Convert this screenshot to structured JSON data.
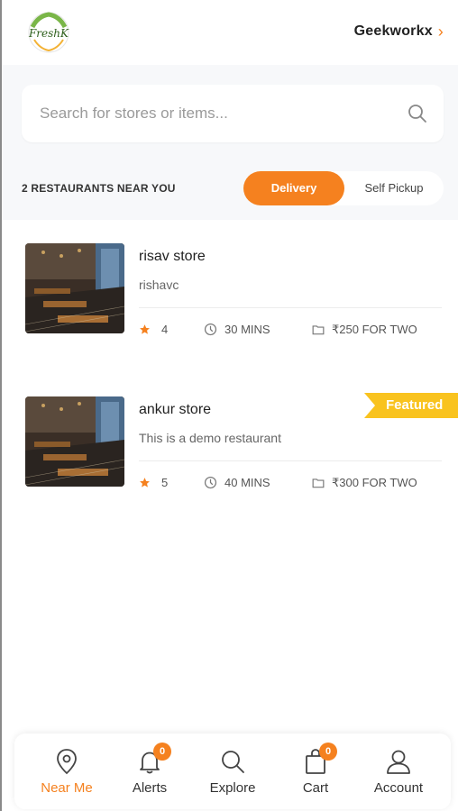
{
  "header": {
    "location_label": "Geekworkx",
    "logo_icon": "fresh-k-logo",
    "chevron_icon": "chevron-right-icon"
  },
  "search": {
    "placeholder": "Search for stores or items...",
    "value": ""
  },
  "listing": {
    "count_label": "2 RESTAURANTS NEAR YOU",
    "toggle": {
      "delivery": "Delivery",
      "self_pickup": "Self Pickup",
      "selected": "Delivery"
    }
  },
  "stores": [
    {
      "name": "risav store",
      "description": "rishavc",
      "rating": "4",
      "time": "30 MINS",
      "price": "₹250 FOR TWO",
      "featured": false
    },
    {
      "name": "ankur store",
      "description": "This is a demo restaurant",
      "rating": "5",
      "time": "40 MINS",
      "price": "₹300 FOR TWO",
      "featured": true,
      "featured_label": "Featured"
    }
  ],
  "nav": {
    "items": [
      {
        "label": "Near Me",
        "icon": "location-pin-icon",
        "active": true
      },
      {
        "label": "Alerts",
        "icon": "bell-icon",
        "badge": "0"
      },
      {
        "label": "Explore",
        "icon": "search-icon"
      },
      {
        "label": "Cart",
        "icon": "shopping-bag-icon",
        "badge": "0"
      },
      {
        "label": "Account",
        "icon": "user-icon"
      }
    ]
  },
  "colors": {
    "accent": "#f5811f",
    "featured": "#f9c31f",
    "background": "#f7f8fa"
  }
}
